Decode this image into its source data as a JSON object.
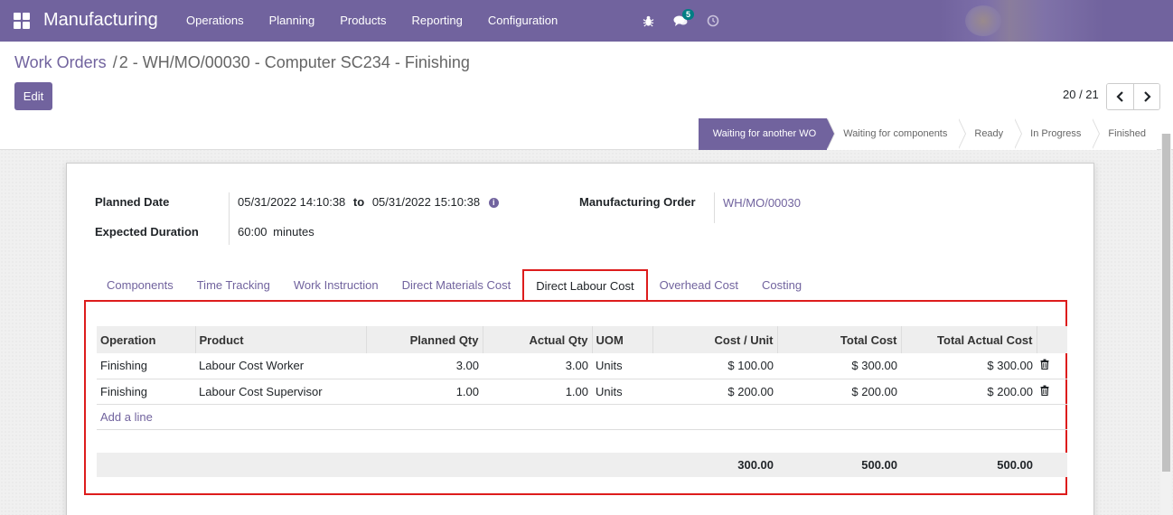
{
  "navbar": {
    "app_name": "Manufacturing",
    "menu": [
      "Operations",
      "Planning",
      "Products",
      "Reporting",
      "Configuration"
    ],
    "message_count": "5"
  },
  "breadcrumb": {
    "parent": "Work Orders",
    "separator": "/",
    "current": "2 - WH/MO/00030 - Computer SC234 - Finishing"
  },
  "buttons": {
    "edit": "Edit"
  },
  "pager": {
    "value": "20 / 21"
  },
  "status_steps": [
    "Waiting for another WO",
    "Waiting for components",
    "Ready",
    "In Progress",
    "Finished"
  ],
  "status_active": "Waiting for another WO",
  "form": {
    "planned_date_label": "Planned Date",
    "planned_start": "05/31/2022 14:10:38",
    "to_label": "to",
    "planned_end": "05/31/2022 15:10:38",
    "expected_duration_label": "Expected Duration",
    "expected_duration_value": "60:00",
    "expected_duration_unit": "minutes",
    "mo_label": "Manufacturing Order",
    "mo_value": "WH/MO/00030"
  },
  "tabs": [
    "Components",
    "Time Tracking",
    "Work Instruction",
    "Direct Materials Cost",
    "Direct Labour Cost",
    "Overhead Cost",
    "Costing"
  ],
  "active_tab": "Direct Labour Cost",
  "table": {
    "headers": [
      "Operation",
      "Product",
      "Planned Qty",
      "Actual Qty",
      "UOM",
      "Cost / Unit",
      "Total Cost",
      "Total Actual Cost"
    ],
    "rows": [
      {
        "operation": "Finishing",
        "product": "Labour Cost Worker",
        "planned_qty": "3.00",
        "actual_qty": "3.00",
        "uom": "Units",
        "cost_unit": "$ 100.00",
        "total_cost": "$ 300.00",
        "total_actual_cost": "$ 300.00"
      },
      {
        "operation": "Finishing",
        "product": "Labour Cost Supervisor",
        "planned_qty": "1.00",
        "actual_qty": "1.00",
        "uom": "Units",
        "cost_unit": "$ 200.00",
        "total_cost": "$ 200.00",
        "total_actual_cost": "$ 200.00"
      }
    ],
    "add_line": "Add a line",
    "totals": {
      "cost_unit": "300.00",
      "total_cost": "500.00",
      "total_actual_cost": "500.00"
    }
  },
  "icons": {
    "apps": "apps-grid-icon",
    "bug": "bug-icon",
    "messages": "chat-icon",
    "activity": "clock-icon",
    "info": "info-icon",
    "delete": "trash-icon",
    "prev": "chevron-left-icon",
    "next": "chevron-right-icon"
  },
  "colors": {
    "brand": "#71639e",
    "highlight": "#dd1c1c",
    "badge": "#017e84"
  }
}
